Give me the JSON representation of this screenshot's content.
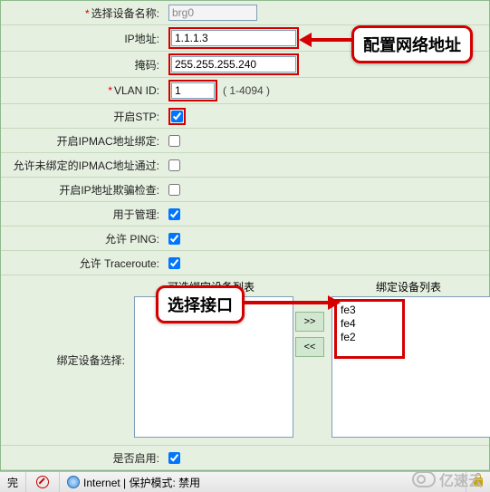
{
  "labels": {
    "device_name": "选择设备名称:",
    "ip": "IP地址:",
    "mask": "掩码:",
    "vlan": "VLAN ID:",
    "stp": "开启STP:",
    "ipmac": "开启IPMAC地址绑定:",
    "ipmac_pass": "允许未绑定的IPMAC地址通过:",
    "ipspoof": "开启IP地址欺骗检查:",
    "mgmt": "用于管理:",
    "ping": "允许 PING:",
    "traceroute": "允许 Traceroute:",
    "bind_sel": "绑定设备选择:",
    "enable": "是否启用:",
    "avail": "可选绑定设备列表",
    "bound": "绑定设备列表"
  },
  "values": {
    "device_name": "brg0",
    "ip": "1.1.1.3",
    "mask": "255.255.255.240",
    "vlan": "1",
    "vlan_hint": "( 1-4094 )"
  },
  "checks": {
    "stp": true,
    "ipmac": false,
    "ipmac_pass": false,
    "ipspoof": false,
    "mgmt": true,
    "ping": true,
    "traceroute": true,
    "enable": true
  },
  "bound_items": [
    "fe3",
    "fe4",
    "fe2"
  ],
  "buttons": {
    "add": ">>",
    "remove": "<<"
  },
  "callouts": {
    "net": "配置网络地址",
    "iface": "选择接口"
  },
  "status": {
    "done": "完",
    "net": "Internet | 保护模式: 禁用"
  },
  "brand": "亿速云"
}
